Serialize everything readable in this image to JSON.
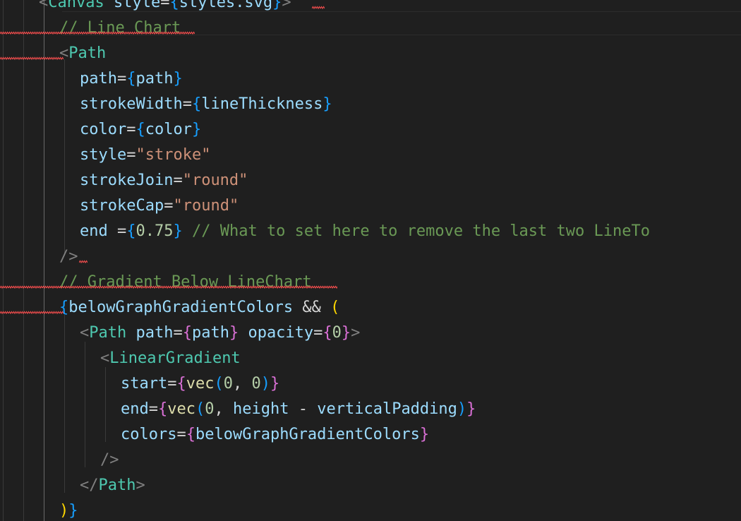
{
  "editor": {
    "lines": [
      {
        "indent": 2,
        "tokens": [
          {
            "t": "<",
            "c": "punct"
          },
          {
            "t": "Canvas",
            "c": "tag"
          },
          {
            "t": " style",
            "c": "attr"
          },
          {
            "t": "=",
            "c": "op"
          },
          {
            "t": "{",
            "c": "b1"
          },
          {
            "t": "styles.svg",
            "c": "var"
          },
          {
            "t": "}",
            "c": "b1"
          },
          {
            "t": ">",
            "c": "punct"
          }
        ]
      },
      {
        "indent": 3,
        "tokens": [
          {
            "t": "// Line Chart",
            "c": "comment"
          }
        ]
      },
      {
        "indent": 3,
        "tokens": [
          {
            "t": "<",
            "c": "punct"
          },
          {
            "t": "Path",
            "c": "tag"
          }
        ]
      },
      {
        "indent": 4,
        "tokens": [
          {
            "t": "path",
            "c": "attr"
          },
          {
            "t": "=",
            "c": "op"
          },
          {
            "t": "{",
            "c": "b1"
          },
          {
            "t": "path",
            "c": "var"
          },
          {
            "t": "}",
            "c": "b1"
          }
        ]
      },
      {
        "indent": 4,
        "tokens": [
          {
            "t": "strokeWidth",
            "c": "attr"
          },
          {
            "t": "=",
            "c": "op"
          },
          {
            "t": "{",
            "c": "b1"
          },
          {
            "t": "lineThickness",
            "c": "var"
          },
          {
            "t": "}",
            "c": "b1"
          }
        ]
      },
      {
        "indent": 4,
        "tokens": [
          {
            "t": "color",
            "c": "attr"
          },
          {
            "t": "=",
            "c": "op"
          },
          {
            "t": "{",
            "c": "b1"
          },
          {
            "t": "color",
            "c": "var"
          },
          {
            "t": "}",
            "c": "b1"
          }
        ]
      },
      {
        "indent": 4,
        "tokens": [
          {
            "t": "style",
            "c": "attr"
          },
          {
            "t": "=",
            "c": "op"
          },
          {
            "t": "\"stroke\"",
            "c": "str"
          }
        ]
      },
      {
        "indent": 4,
        "tokens": [
          {
            "t": "strokeJoin",
            "c": "attr"
          },
          {
            "t": "=",
            "c": "op"
          },
          {
            "t": "\"round\"",
            "c": "str"
          }
        ]
      },
      {
        "indent": 4,
        "tokens": [
          {
            "t": "strokeCap",
            "c": "attr"
          },
          {
            "t": "=",
            "c": "op"
          },
          {
            "t": "\"round\"",
            "c": "str"
          }
        ]
      },
      {
        "indent": 4,
        "tokens": [
          {
            "t": "end",
            "c": "attr"
          },
          {
            "t": " =",
            "c": "op"
          },
          {
            "t": "{",
            "c": "b1"
          },
          {
            "t": "0.75",
            "c": "num"
          },
          {
            "t": "}",
            "c": "b1"
          },
          {
            "t": " // What to set here to remove the last two LineTo",
            "c": "comment"
          }
        ]
      },
      {
        "indent": 3,
        "tokens": [
          {
            "t": "/>",
            "c": "punct"
          }
        ]
      },
      {
        "indent": 3,
        "tokens": [
          {
            "t": "// Gradient Below LineChart",
            "c": "comment"
          }
        ]
      },
      {
        "indent": 3,
        "tokens": [
          {
            "t": "{",
            "c": "b1"
          },
          {
            "t": "belowGraphGradientColors",
            "c": "var"
          },
          {
            "t": " && ",
            "c": "op"
          },
          {
            "t": "(",
            "c": "b3"
          }
        ]
      },
      {
        "indent": 4,
        "tokens": [
          {
            "t": "<",
            "c": "punct"
          },
          {
            "t": "Path",
            "c": "tag"
          },
          {
            "t": " path",
            "c": "attr"
          },
          {
            "t": "=",
            "c": "op"
          },
          {
            "t": "{",
            "c": "b2"
          },
          {
            "t": "path",
            "c": "var"
          },
          {
            "t": "}",
            "c": "b2"
          },
          {
            "t": " opacity",
            "c": "attr"
          },
          {
            "t": "=",
            "c": "op"
          },
          {
            "t": "{",
            "c": "b2"
          },
          {
            "t": "0",
            "c": "num"
          },
          {
            "t": "}",
            "c": "b2"
          },
          {
            "t": ">",
            "c": "punct"
          }
        ]
      },
      {
        "indent": 5,
        "tokens": [
          {
            "t": "<",
            "c": "punct"
          },
          {
            "t": "LinearGradient",
            "c": "tag"
          }
        ]
      },
      {
        "indent": 6,
        "tokens": [
          {
            "t": "start",
            "c": "attr"
          },
          {
            "t": "=",
            "c": "op"
          },
          {
            "t": "{",
            "c": "b2"
          },
          {
            "t": "vec",
            "c": "fn"
          },
          {
            "t": "(",
            "c": "b1"
          },
          {
            "t": "0",
            "c": "num"
          },
          {
            "t": ", ",
            "c": "op"
          },
          {
            "t": "0",
            "c": "num"
          },
          {
            "t": ")",
            "c": "b1"
          },
          {
            "t": "}",
            "c": "b2"
          }
        ]
      },
      {
        "indent": 6,
        "tokens": [
          {
            "t": "end",
            "c": "attr"
          },
          {
            "t": "=",
            "c": "op"
          },
          {
            "t": "{",
            "c": "b2"
          },
          {
            "t": "vec",
            "c": "fn"
          },
          {
            "t": "(",
            "c": "b1"
          },
          {
            "t": "0",
            "c": "num"
          },
          {
            "t": ", ",
            "c": "op"
          },
          {
            "t": "height",
            "c": "var"
          },
          {
            "t": " - ",
            "c": "op"
          },
          {
            "t": "verticalPadding",
            "c": "var"
          },
          {
            "t": ")",
            "c": "b1"
          },
          {
            "t": "}",
            "c": "b2"
          }
        ]
      },
      {
        "indent": 6,
        "tokens": [
          {
            "t": "colors",
            "c": "attr"
          },
          {
            "t": "=",
            "c": "op"
          },
          {
            "t": "{",
            "c": "b2"
          },
          {
            "t": "belowGraphGradientColors",
            "c": "var"
          },
          {
            "t": "}",
            "c": "b2"
          }
        ]
      },
      {
        "indent": 5,
        "tokens": [
          {
            "t": "/>",
            "c": "punct"
          }
        ]
      },
      {
        "indent": 4,
        "tokens": [
          {
            "t": "</",
            "c": "punct"
          },
          {
            "t": "Path",
            "c": "tag"
          },
          {
            "t": ">",
            "c": "punct"
          }
        ]
      },
      {
        "indent": 3,
        "tokens": [
          {
            "t": ")",
            "c": "b3"
          },
          {
            "t": "}",
            "c": "b1"
          }
        ]
      }
    ]
  }
}
